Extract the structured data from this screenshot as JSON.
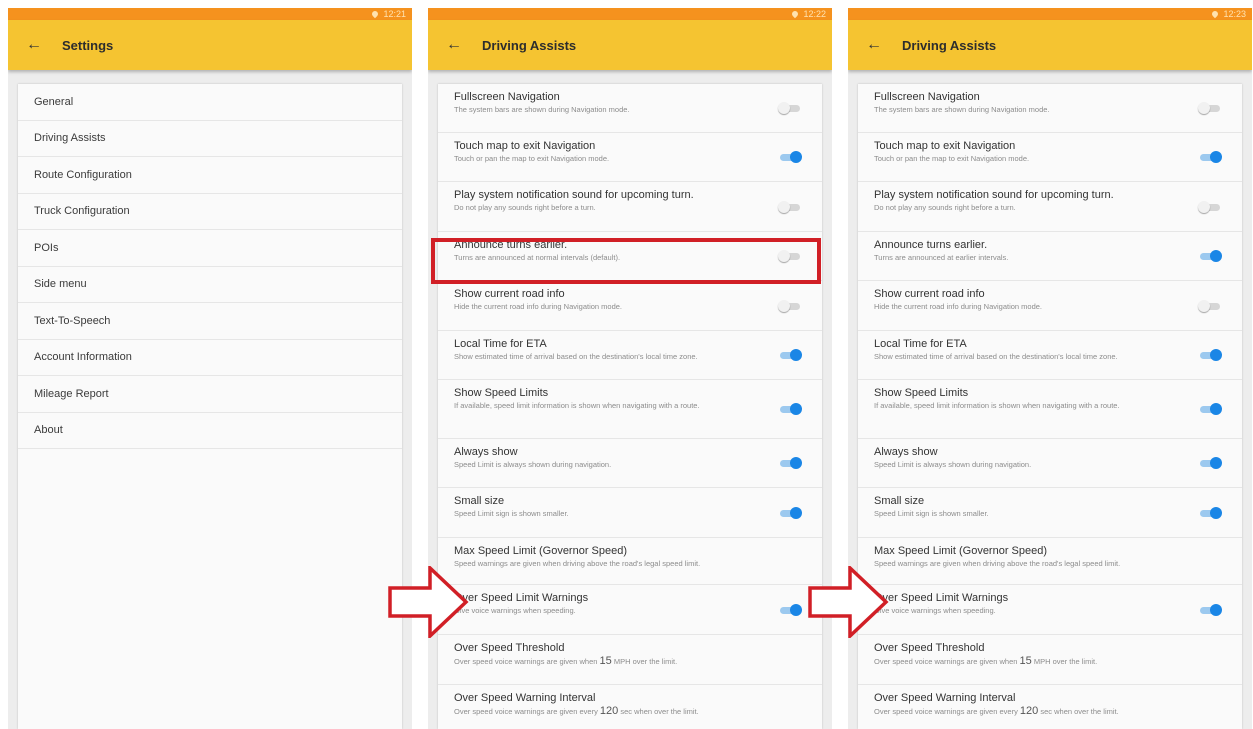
{
  "panels": [
    {
      "time": "12:21",
      "title": "Settings",
      "items": [
        "General",
        "Driving Assists",
        "Route Configuration",
        "Truck Configuration",
        "POIs",
        "Side menu",
        "Text-To-Speech",
        "Account Information",
        "Mileage Report",
        "About"
      ]
    },
    {
      "time": "12:22",
      "title": "Driving Assists",
      "rows": [
        {
          "title": "Fullscreen Navigation",
          "sub": "The system bars are shown during Navigation mode.",
          "toggle": "off"
        },
        {
          "title": "Touch map to exit Navigation",
          "sub": "Touch or pan the map to exit Navigation mode.",
          "toggle": "on"
        },
        {
          "title": "Play system notification sound for upcoming turn.",
          "sub": "Do not play any sounds right before a turn.",
          "toggle": "off"
        },
        {
          "title": "Announce turns earlier.",
          "sub": "Turns are announced at normal intervals (default).",
          "toggle": "off"
        },
        {
          "title": "Show current road info",
          "sub": "Hide the current road info during Navigation mode.",
          "toggle": "off"
        },
        {
          "title": "Local Time for ETA",
          "sub": "Show estimated time of arrival based on the destination's local time zone.",
          "toggle": "on"
        },
        {
          "title": "Show Speed Limits",
          "sub": "If available, speed limit information is shown when navigating with a route.",
          "toggle": "on"
        },
        {
          "title": "Always show",
          "sub": "Speed Limit is always shown during navigation.",
          "toggle": "on"
        },
        {
          "title": "Small size",
          "sub": "Speed Limit sign is shown smaller.",
          "toggle": "on"
        },
        {
          "title": "Max Speed Limit (Governor Speed)",
          "sub": "Speed warnings are given when driving above the road's legal speed limit.",
          "toggle": "none"
        },
        {
          "title": "Over Speed Limit Warnings",
          "sub": "Give voice warnings when speeding.",
          "toggle": "on"
        },
        {
          "title": "Over Speed Threshold",
          "sub_pre": "Over speed voice warnings are given when ",
          "sub_big": "15",
          "sub_post": " MPH over the limit.",
          "toggle": "none"
        },
        {
          "title": "Over Speed Warning Interval",
          "sub_pre": "Over speed voice warnings are given every ",
          "sub_big": "120",
          "sub_post": " sec when over the limit.",
          "toggle": "none"
        }
      ]
    },
    {
      "time": "12:23",
      "title": "Driving Assists",
      "rows": [
        {
          "title": "Fullscreen Navigation",
          "sub": "The system bars are shown during Navigation mode.",
          "toggle": "off"
        },
        {
          "title": "Touch map to exit Navigation",
          "sub": "Touch or pan the map to exit Navigation mode.",
          "toggle": "on"
        },
        {
          "title": "Play system notification sound for upcoming turn.",
          "sub": "Do not play any sounds right before a turn.",
          "toggle": "off"
        },
        {
          "title": "Announce turns earlier.",
          "sub": "Turns are announced at earlier intervals.",
          "toggle": "on"
        },
        {
          "title": "Show current road info",
          "sub": "Hide the current road info during Navigation mode.",
          "toggle": "off"
        },
        {
          "title": "Local Time for ETA",
          "sub": "Show estimated time of arrival based on the destination's local time zone.",
          "toggle": "on"
        },
        {
          "title": "Show Speed Limits",
          "sub": "If available, speed limit information is shown when navigating with a route.",
          "toggle": "on"
        },
        {
          "title": "Always show",
          "sub": "Speed Limit is always shown during navigation.",
          "toggle": "on"
        },
        {
          "title": "Small size",
          "sub": "Speed Limit sign is shown smaller.",
          "toggle": "on"
        },
        {
          "title": "Max Speed Limit (Governor Speed)",
          "sub": "Speed warnings are given when driving above the road's legal speed limit.",
          "toggle": "none"
        },
        {
          "title": "Over Speed Limit Warnings",
          "sub": "Give voice warnings when speeding.",
          "toggle": "on"
        },
        {
          "title": "Over Speed Threshold",
          "sub_pre": "Over speed voice warnings are given when ",
          "sub_big": "15",
          "sub_post": " MPH over the limit.",
          "toggle": "none"
        },
        {
          "title": "Over Speed Warning Interval",
          "sub_pre": "Over speed voice warnings are given every ",
          "sub_big": "120",
          "sub_post": " sec when over the limit.",
          "toggle": "none"
        }
      ]
    }
  ],
  "colors": {
    "statusbar": "#f5921e",
    "appbar": "#f5c431",
    "toggle_on": "#1a86e6",
    "highlight": "#d11f26"
  },
  "icons": {
    "back": "arrow-left-icon",
    "location": "location-pin-icon",
    "annotation": "right-arrow-annotation-icon"
  }
}
